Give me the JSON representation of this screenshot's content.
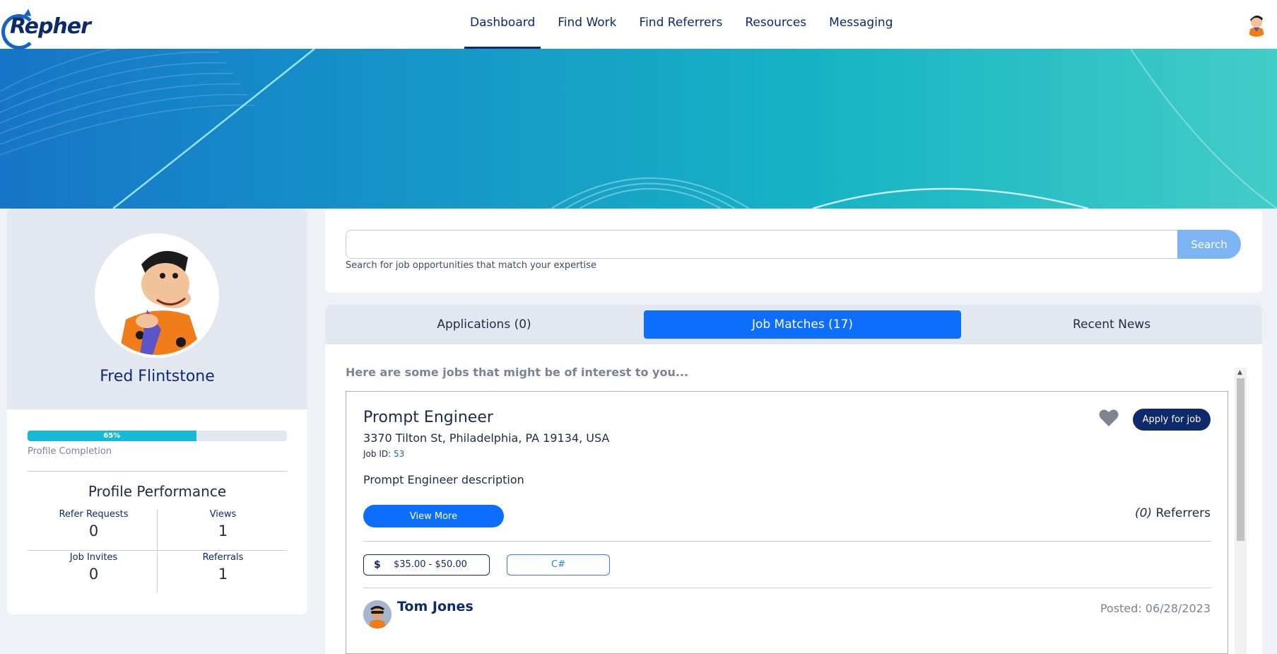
{
  "brand": {
    "logo_text": "Repher"
  },
  "nav": {
    "items": [
      {
        "label": "Dashboard",
        "active": true
      },
      {
        "label": "Find Work",
        "active": false
      },
      {
        "label": "Find Referrers",
        "active": false
      },
      {
        "label": "Resources",
        "active": false
      },
      {
        "label": "Messaging",
        "active": false
      }
    ]
  },
  "profile": {
    "name": "Fred Flintstone",
    "completion_percent": 65,
    "completion_text": "65%",
    "completion_label": "Profile Completion",
    "performance_title": "Profile Performance",
    "stats": [
      {
        "label": "Refer Requests",
        "value": "0"
      },
      {
        "label": "Views",
        "value": "1"
      },
      {
        "label": "Job Invites",
        "value": "0"
      },
      {
        "label": "Referrals",
        "value": "1"
      }
    ]
  },
  "search": {
    "value": "",
    "placeholder": "",
    "button_label": "Search",
    "hint": "Search for job opportunities that match your expertise"
  },
  "tabs": [
    {
      "label": "Applications (0)",
      "active": false
    },
    {
      "label": "Job Matches (17)",
      "active": true
    },
    {
      "label": "Recent News",
      "active": false
    }
  ],
  "job_matches": {
    "intro": "Here are some jobs that might be of interest to you...",
    "jobs": [
      {
        "title": "Prompt Engineer",
        "address": "3370 Tilton St, Philadelphia, PA 19134, USA",
        "job_id_label": "Job ID:",
        "job_id": "53",
        "description": "Prompt Engineer description",
        "apply_label": "Apply for job",
        "view_more_label": "View More",
        "referrer_count": "(0)",
        "referrer_label": "Referrers",
        "pay_icon": "dollar-icon",
        "pay_symbol": "$",
        "pay_range": "$35.00 - $50.00",
        "skills": [
          "C#"
        ],
        "poster_name": "Tom Jones",
        "posted": "Posted: 06/28/2023"
      }
    ]
  },
  "colors": {
    "primary": "#0d6efd",
    "navy": "#0d2a6b",
    "progress": "#16b9d6",
    "search_button": "#7db4f4"
  }
}
